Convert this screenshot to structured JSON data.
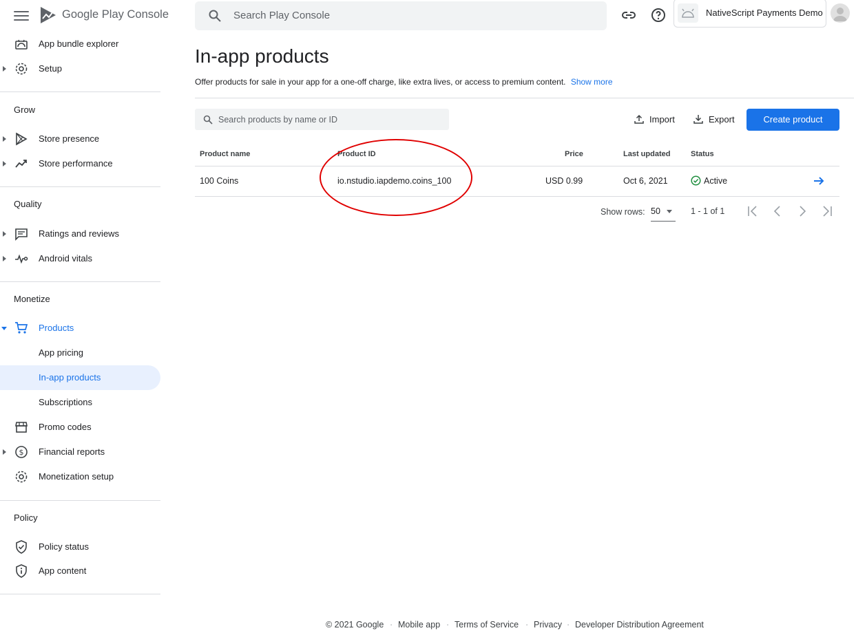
{
  "header": {
    "brand_text": "Google Play Console",
    "search_placeholder": "Search Play Console",
    "app_name": "NativeScript Payments Demo"
  },
  "sidebar": {
    "top_items": [
      {
        "label": "App bundle explorer",
        "icon": "android-icon"
      },
      {
        "label": "Setup",
        "icon": "gear-icon",
        "expandable": true
      }
    ],
    "sections": {
      "grow": {
        "title": "Grow",
        "items": [
          {
            "label": "Store presence",
            "icon": "play-icon"
          },
          {
            "label": "Store performance",
            "icon": "trending-icon"
          }
        ]
      },
      "quality": {
        "title": "Quality",
        "items": [
          {
            "label": "Ratings and reviews",
            "icon": "review-icon"
          },
          {
            "label": "Android vitals",
            "icon": "pulse-icon"
          }
        ]
      },
      "monetize": {
        "title": "Monetize",
        "items": [
          {
            "label": "Products",
            "icon": "cart-icon"
          },
          {
            "label": "App pricing"
          },
          {
            "label": "In-app products"
          },
          {
            "label": "Subscriptions"
          },
          {
            "label": "Promo codes",
            "icon": "store-icon"
          },
          {
            "label": "Financial reports",
            "icon": "dollar-icon"
          },
          {
            "label": "Monetization setup",
            "icon": "gear-icon"
          }
        ]
      },
      "policy": {
        "title": "Policy",
        "items": [
          {
            "label": "Policy status",
            "icon": "shield-check-icon"
          },
          {
            "label": "App content",
            "icon": "shield-info-icon"
          }
        ]
      }
    }
  },
  "main": {
    "title": "In-app products",
    "description": "Offer products for sale in your app for a one-off charge, like extra lives, or access to premium content.",
    "show_more": "Show more",
    "product_search_placeholder": "Search products by name or ID",
    "import_label": "Import",
    "export_label": "Export",
    "create_label": "Create product",
    "table": {
      "columns": [
        "Product name",
        "Product ID",
        "Price",
        "Last updated",
        "Status"
      ],
      "rows": [
        {
          "name": "100 Coins",
          "id": "io.nstudio.iapdemo.coins_100",
          "price": "USD 0.99",
          "updated": "Oct 6, 2021",
          "status": "Active"
        }
      ]
    },
    "pager": {
      "rows_label": "Show rows:",
      "rows_value": "50",
      "range": "1 - 1 of 1"
    }
  },
  "footer": {
    "items": [
      "© 2021 Google",
      "Mobile app",
      "Terms of Service",
      "Privacy",
      "Developer Distribution Agreement"
    ]
  },
  "colors": {
    "accent": "#1a73e8",
    "selected_bg": "#e8f0fe",
    "status_green": "#1e8e3e",
    "annotation_red": "#e00000"
  }
}
